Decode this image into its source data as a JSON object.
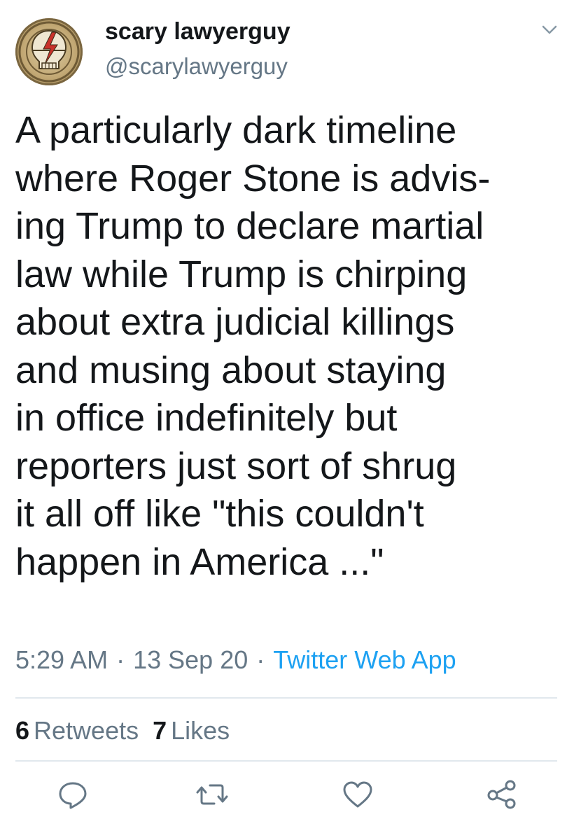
{
  "user": {
    "display_name": "scary lawyerguy",
    "handle": "@scarylawyerguy",
    "avatar_icon": "steal-your-face-skull-icon"
  },
  "tweet": {
    "text": "A particularly dark timeline\nwhere Roger Stone is advis-\ning Trump to declare martial\nlaw while Trump is chirping\nabout extra judicial killings\nand musing about staying\nin office indefinitely but\nreporters just sort of shrug\nit all off like \"this couldn't\nhappen in America ...\"",
    "time": "5:29 AM",
    "separator": "·",
    "date": "13 Sep 20",
    "source": "Twitter Web App"
  },
  "stats": {
    "retweets_count": "6",
    "retweets_label": "Retweets",
    "likes_count": "7",
    "likes_label": "Likes"
  },
  "actions": [
    "reply-icon",
    "retweet-icon",
    "like-icon",
    "share-icon"
  ],
  "colors": {
    "text": "#14171a",
    "secondary": "#657786",
    "link": "#1da1f2",
    "divider": "#e1e8ed"
  }
}
